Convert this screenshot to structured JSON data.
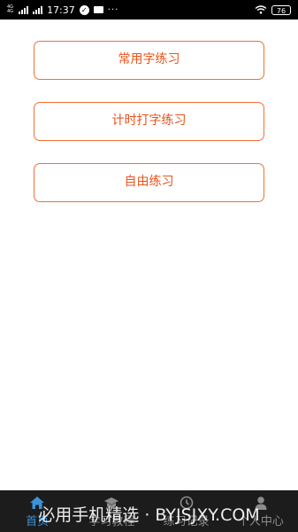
{
  "status_bar": {
    "network_top": "4G",
    "network_bottom": "4G",
    "time": "17:37",
    "round_icon": "phone-clean-icon",
    "mail_icon": "mail-icon",
    "more_dots": "···",
    "battery": "76"
  },
  "menu": {
    "items": [
      {
        "label": "常用字练习"
      },
      {
        "label": "计时打字练习"
      },
      {
        "label": "自由练习"
      }
    ]
  },
  "bottom_nav": {
    "active_color": "#3a92d8",
    "items": [
      {
        "label": "首页",
        "icon": "home-icon"
      },
      {
        "label": "学习教程",
        "icon": "tutorial-icon"
      },
      {
        "label": "练习记录",
        "icon": "history-icon"
      },
      {
        "label": "个人中心",
        "icon": "profile-icon"
      }
    ]
  },
  "watermark": "必用手机精选 · BYJSJXY.COM"
}
